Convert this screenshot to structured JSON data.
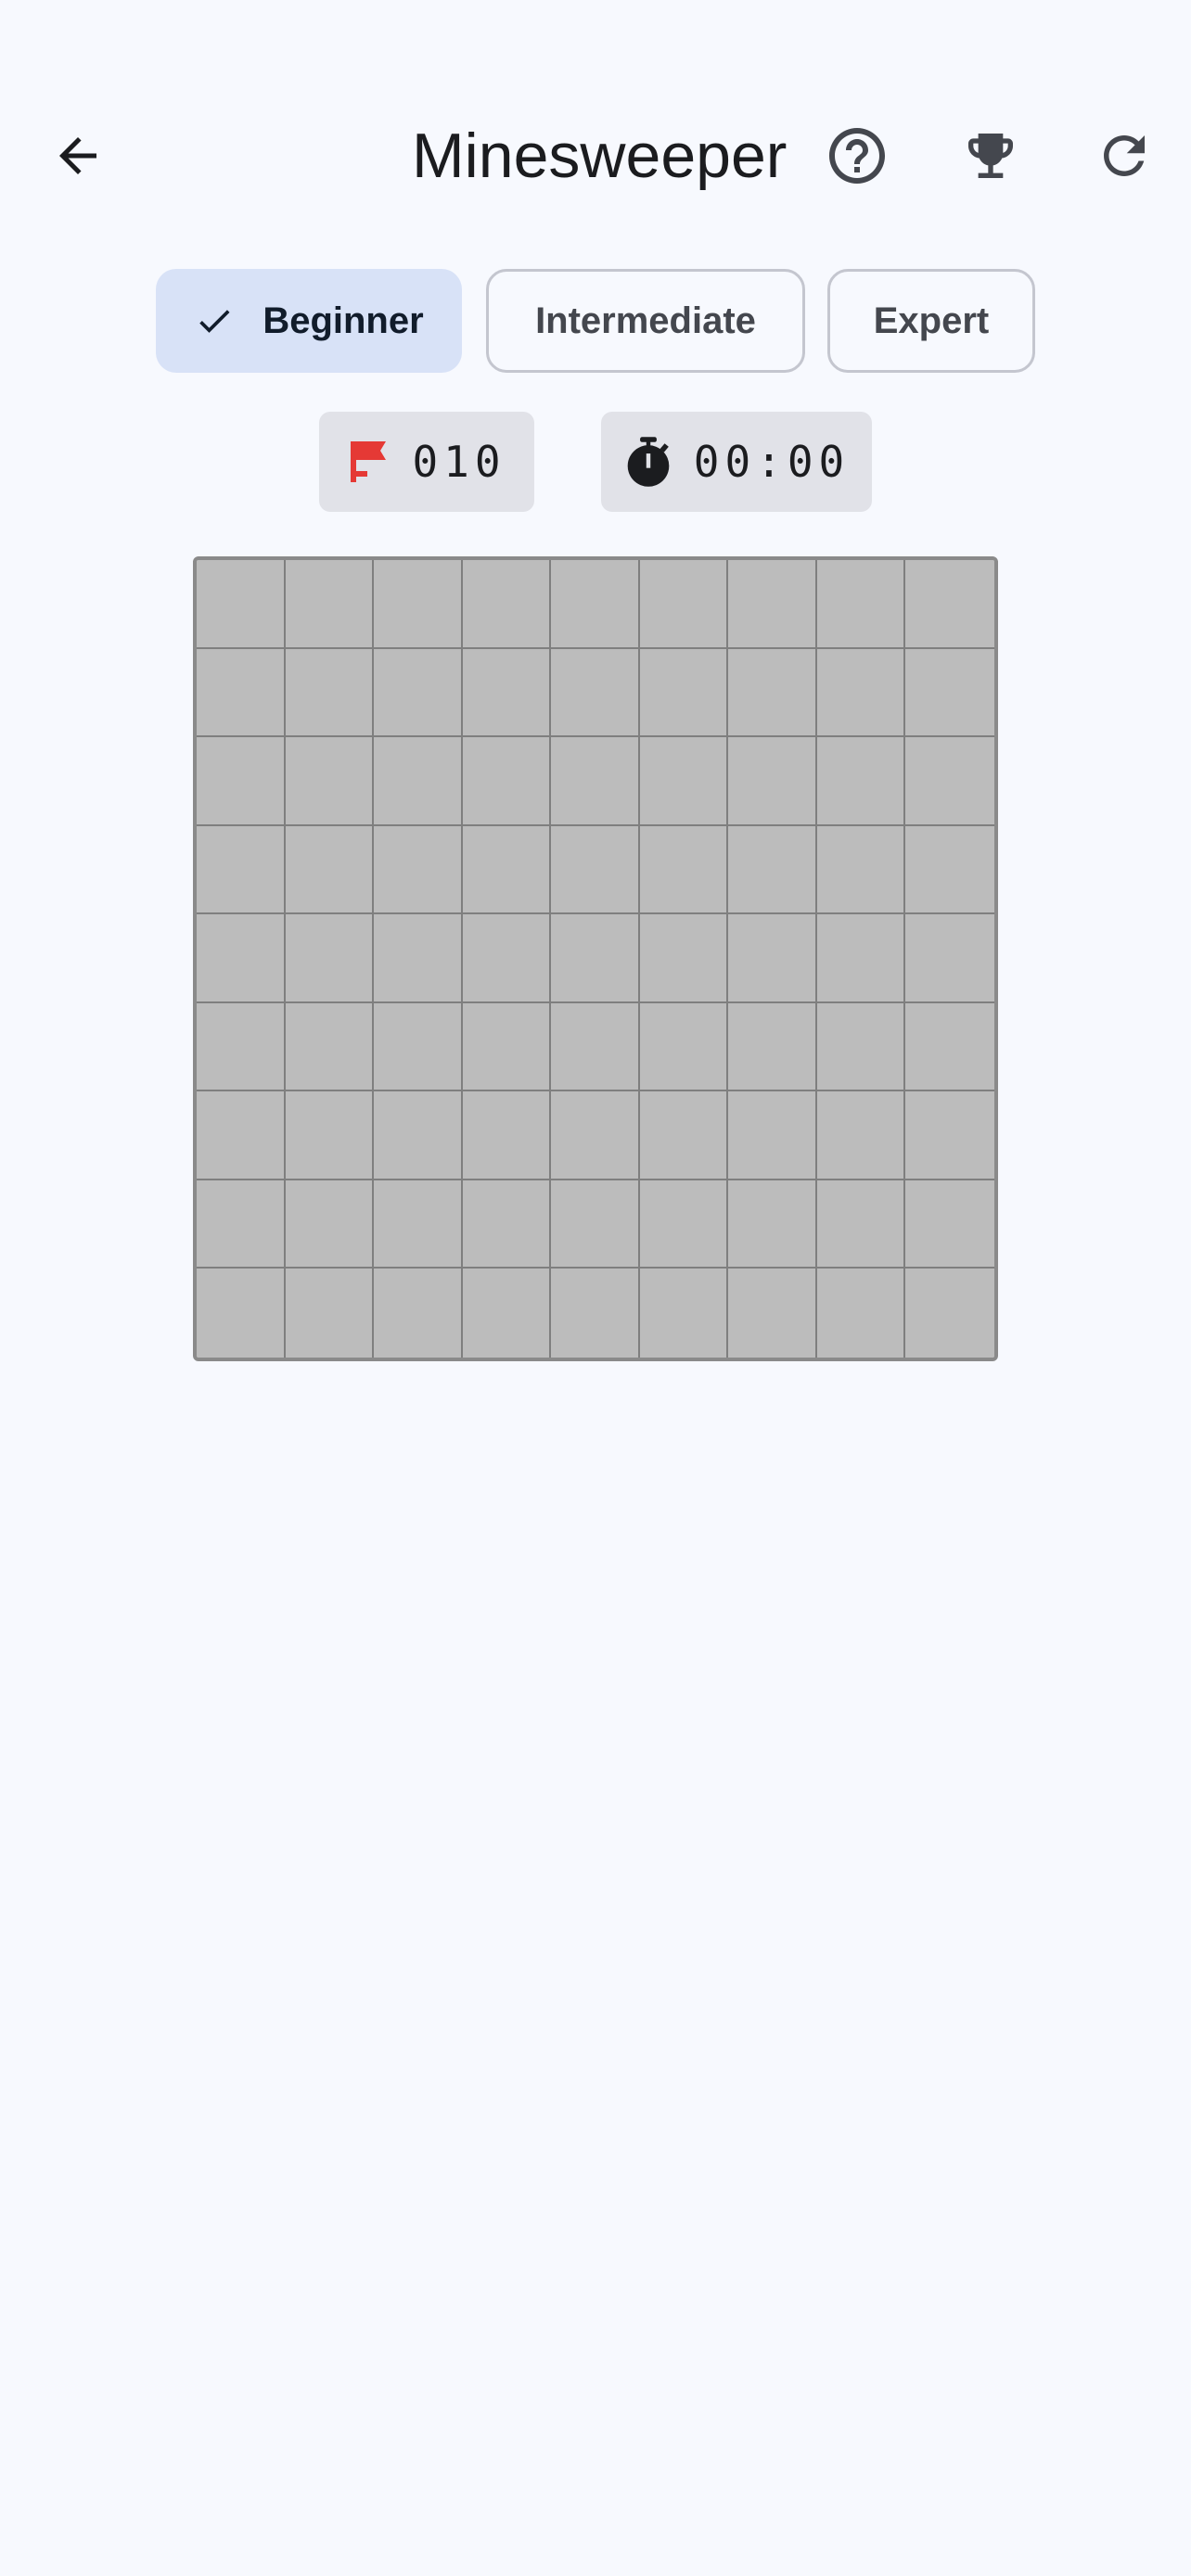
{
  "app": {
    "title": "Minesweeper"
  },
  "toolbar": {
    "back_icon": "arrow-back-icon",
    "help_icon": "help-circle-icon",
    "leaderboard_icon": "trophy-icon",
    "restart_icon": "refresh-icon"
  },
  "difficulty": {
    "options": [
      {
        "label": "Beginner",
        "selected": true
      },
      {
        "label": "Intermediate",
        "selected": false
      },
      {
        "label": "Expert",
        "selected": false
      }
    ]
  },
  "status": {
    "mines_remaining": "010",
    "timer": "00:00",
    "flag_icon": "flag-icon",
    "timer_icon": "stopwatch-icon",
    "flag_color": "#e53935"
  },
  "board": {
    "rows": 9,
    "columns": 9,
    "state": "all-unrevealed"
  }
}
